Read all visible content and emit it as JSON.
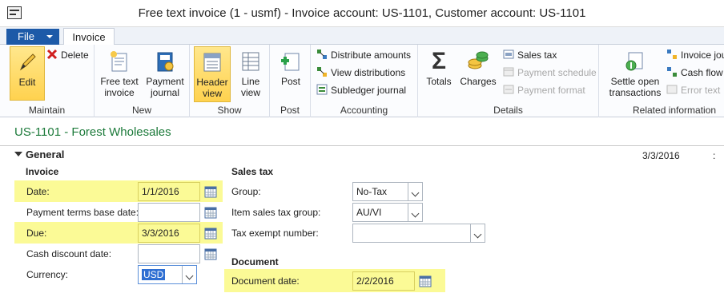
{
  "window": {
    "title": "Free text invoice (1 - usmf) - Invoice account: US-1101, Customer account: US-1101"
  },
  "tabs": {
    "file": "File",
    "invoice": "Invoice"
  },
  "ribbon": {
    "maintain": {
      "label": "Maintain",
      "edit": "Edit",
      "delete": "Delete"
    },
    "new": {
      "label": "New",
      "free_text_invoice": "Free text invoice",
      "payment_journal": "Payment journal"
    },
    "show": {
      "label": "Show",
      "header_view": "Header view",
      "line_view": "Line view"
    },
    "post": {
      "label": "Post",
      "post": "Post"
    },
    "accounting": {
      "label": "Accounting",
      "distribute": "Distribute amounts",
      "view_distributions": "View distributions",
      "subledger": "Subledger journal"
    },
    "details": {
      "label": "Details",
      "totals": "Totals",
      "charges": "Charges",
      "sales_tax": "Sales tax",
      "payment_schedule": "Payment schedule",
      "payment_format": "Payment format"
    },
    "related": {
      "label": "Related information",
      "settle": "Settle open transactions",
      "invoice_journal": "Invoice jour",
      "cash_flow": "Cash flow",
      "error_text": "Error text"
    }
  },
  "record": {
    "title": "US-1101 - Forest Wholesales"
  },
  "general": {
    "title": "General",
    "date_summary": "3/3/2016",
    "invoice": {
      "heading": "Invoice",
      "date_label": "Date:",
      "date_value": "1/1/2016",
      "payment_terms_label": "Payment terms base date:",
      "payment_terms_value": "",
      "due_label": "Due:",
      "due_value": "3/3/2016",
      "cash_discount_label": "Cash discount date:",
      "cash_discount_value": "",
      "currency_label": "Currency:",
      "currency_value": "USD"
    },
    "sales_tax": {
      "heading": "Sales tax",
      "group_label": "Group:",
      "group_value": "No-Tax",
      "item_group_label": "Item sales tax group:",
      "item_group_value": "AU/VI",
      "exempt_label": "Tax exempt number:",
      "exempt_value": ""
    },
    "document": {
      "heading": "Document",
      "date_label": "Document date:",
      "date_value": "2/2/2016"
    }
  },
  "colors": {
    "accent": "#1d5aa8",
    "highlight": "#fbfa96",
    "record_title": "#1c7a3a",
    "selected_button": "#ffd24f"
  }
}
